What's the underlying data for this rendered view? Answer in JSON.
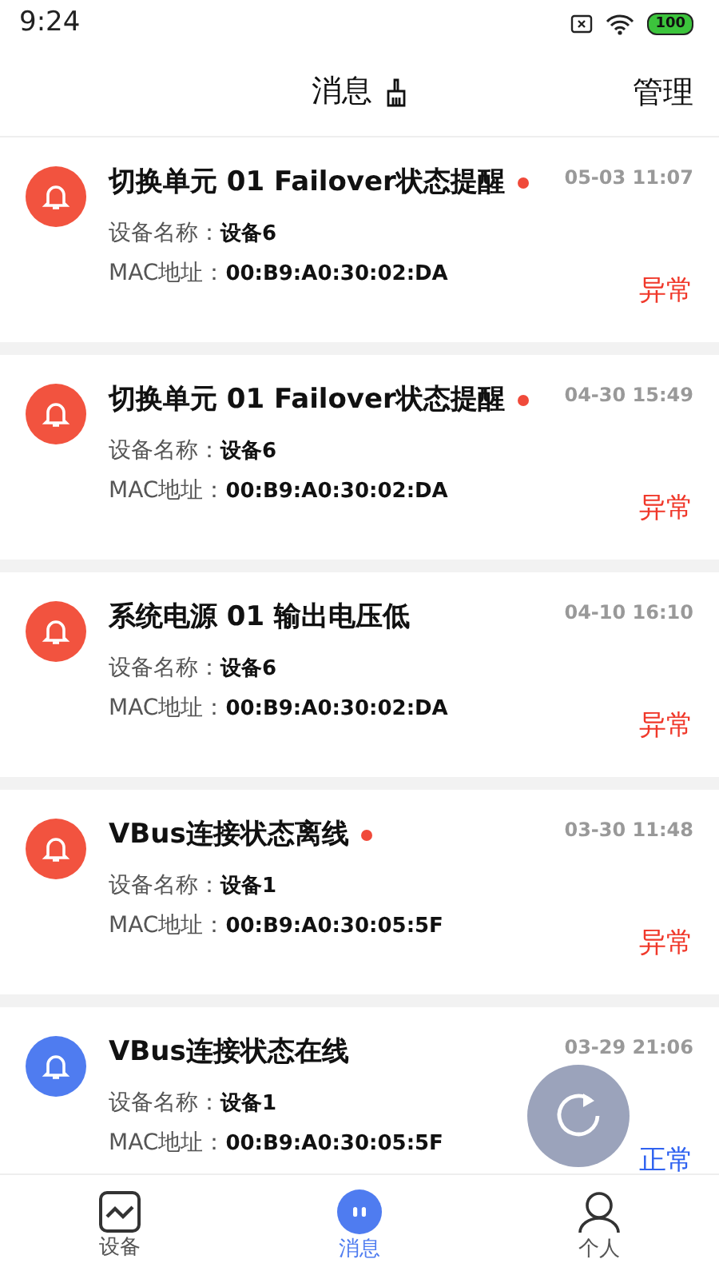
{
  "status_bar": {
    "time": "9:24",
    "battery": "100"
  },
  "header": {
    "title": "消息",
    "action": "管理"
  },
  "messages": [
    {
      "kind": "alarm",
      "title": "切换单元 01 Failover状态提醒",
      "unread": true,
      "time": "05-03 11:07",
      "device_label": "设备名称：",
      "device": "设备6",
      "mac_label": "MAC地址：",
      "mac": "00:B9:A0:30:02:DA",
      "status": "异常"
    },
    {
      "kind": "alarm",
      "title": "切换单元 01 Failover状态提醒",
      "unread": true,
      "time": "04-30 15:49",
      "device_label": "设备名称：",
      "device": "设备6",
      "mac_label": "MAC地址：",
      "mac": "00:B9:A0:30:02:DA",
      "status": "异常"
    },
    {
      "kind": "alarm",
      "title": "系统电源 01 输出电压低",
      "unread": false,
      "time": "04-10 16:10",
      "device_label": "设备名称：",
      "device": "设备6",
      "mac_label": "MAC地址：",
      "mac": "00:B9:A0:30:02:DA",
      "status": "异常"
    },
    {
      "kind": "alarm",
      "title": "VBus连接状态离线",
      "unread": true,
      "time": "03-30 11:48",
      "device_label": "设备名称：",
      "device": "设备1",
      "mac_label": "MAC地址：",
      "mac": "00:B9:A0:30:05:5F",
      "status": "异常"
    },
    {
      "kind": "normal",
      "title": "VBus连接状态在线",
      "unread": false,
      "time": "03-29 21:06",
      "device_label": "设备名称：",
      "device": "设备1",
      "mac_label": "MAC地址：",
      "mac": "00:B9:A0:30:05:5F",
      "status": "正常"
    }
  ],
  "tabs": [
    {
      "label": "设备",
      "selected": false
    },
    {
      "label": "消息",
      "selected": true
    },
    {
      "label": "个人",
      "selected": false
    }
  ]
}
